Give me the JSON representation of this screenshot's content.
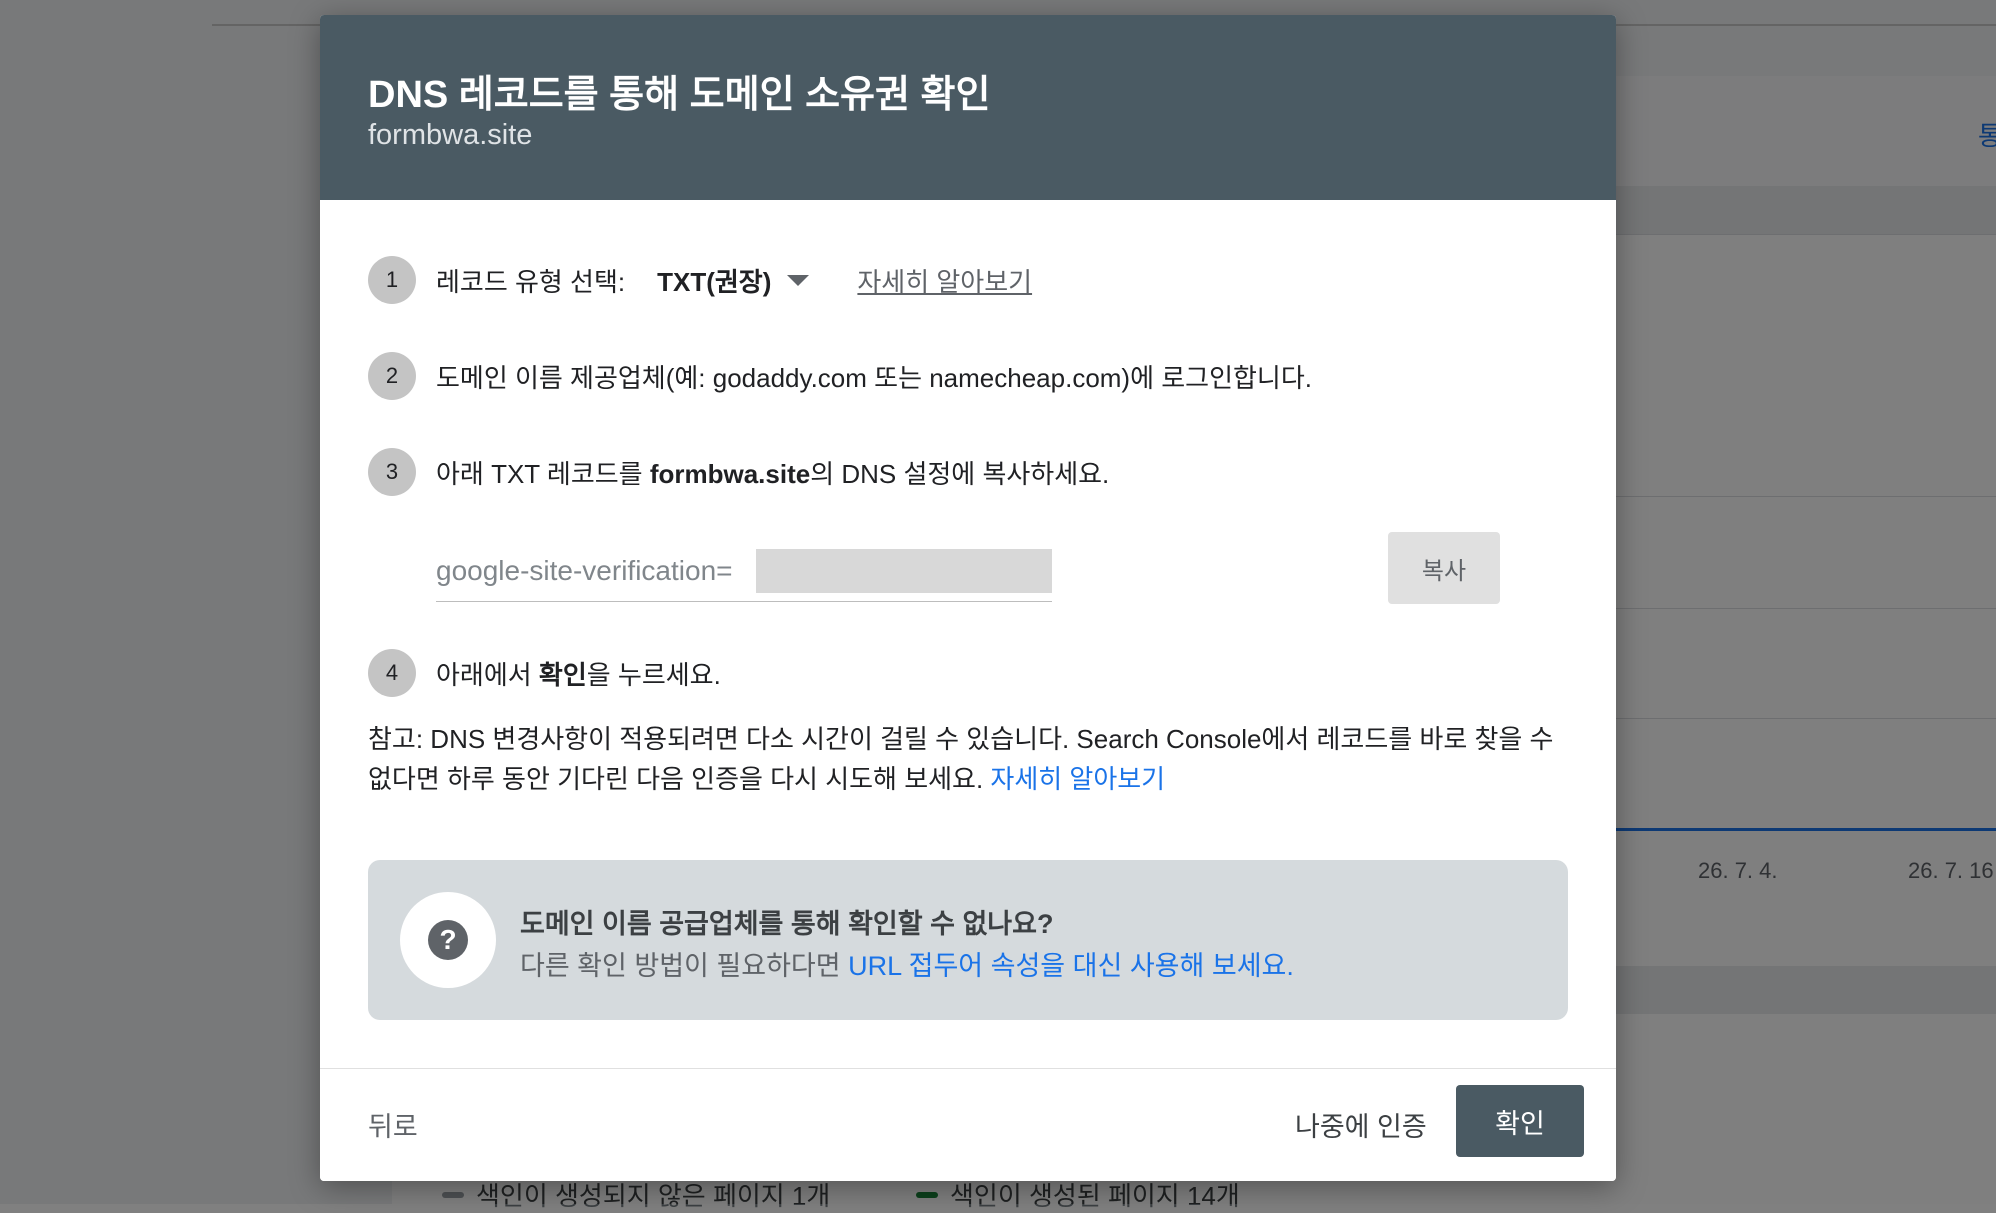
{
  "background": {
    "right_link": "통",
    "ticks": [
      "26. 7. 4.",
      "26. 7. 16"
    ],
    "legend": [
      {
        "label": "색인이 생성되지 않은 페이지 1개",
        "color": "#9aa0a6"
      },
      {
        "label": "색인이 생성된 페이지 14개",
        "color": "#188038"
      }
    ]
  },
  "dialog": {
    "title": "DNS 레코드를 통해 도메인 소유권 확인",
    "subtitle": "formbwa.site",
    "steps": [
      {
        "number": "1",
        "label": "레코드 유형 선택:",
        "record_type": "TXT(권장)",
        "learn_more": "자세히 알아보기"
      },
      {
        "number": "2",
        "text": "도메인 이름 제공업체(예: godaddy.com 또는 namecheap.com)에 로그인합니다."
      },
      {
        "number": "3",
        "text_before": "아래 TXT 레코드를 ",
        "domain": "formbwa.site",
        "text_after": "의 DNS 설정에 복사하세요."
      },
      {
        "number": "4",
        "text_before": "아래에서 ",
        "bold": "확인",
        "text_after": "을 누르세요."
      }
    ],
    "txt_record_prefix": "google-site-verification=",
    "copy_button": "복사",
    "note": "참고: DNS 변경사항이 적용되려면 다소 시간이 걸릴 수 있습니다. Search Console에서 레코드를 바로 찾을 수 없다면 하루 동안 기다린 다음 인증을 다시 시도해 보세요.",
    "note_link": "자세히 알아보기",
    "alt": {
      "title": "도메인 이름 공급업체를 통해 확인할 수 없나요?",
      "desc": "다른 확인 방법이 필요하다면 ",
      "link": "URL 접두어 속성을 대신 사용해 보세요.",
      "icon": "help-circle-icon"
    },
    "footer": {
      "back": "뒤로",
      "later": "나중에 인증",
      "confirm": "확인"
    }
  }
}
